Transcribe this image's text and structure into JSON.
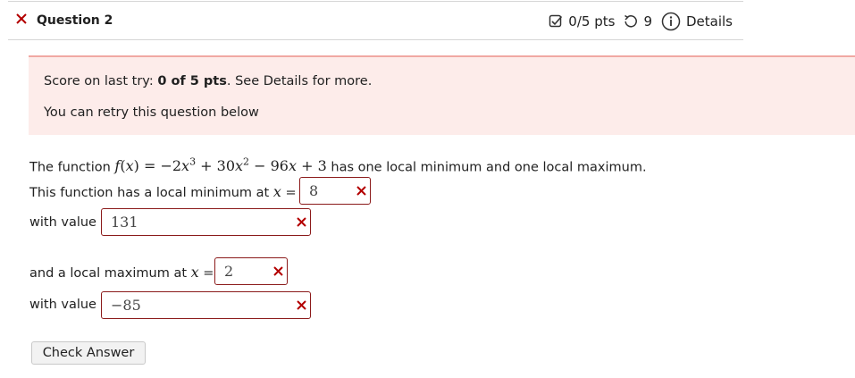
{
  "question": {
    "title": "Question 2",
    "status_icon": "x-icon",
    "score": "0/5 pts",
    "retries": "9",
    "details_label": "Details",
    "icons": [
      "checkbox-icon",
      "retry-icon",
      "info-icon"
    ]
  },
  "alert": {
    "score_prefix": "Score on last try: ",
    "score_bold": "0 of 5 pts",
    "score_suffix": ". See Details for more.",
    "retry_text": "You can retry this question below"
  },
  "problem": {
    "intro_prefix": "The function ",
    "intro_suffix": " has one local minimum and one local maximum.",
    "min_label": "This function has a local minimum at",
    "with_value_label": "with value",
    "max_label": "and a local maximum at",
    "x_equals": "=",
    "math": {
      "fx": "f(x) = −2x³ + 30x² − 96x + 3",
      "x_var": "x"
    }
  },
  "answers": {
    "min_x": "8",
    "min_value": "131",
    "max_x": "2",
    "max_value": "−85",
    "status": "incorrect"
  },
  "buttons": {
    "check_answer": "Check Answer"
  },
  "colors": {
    "wrong": "#b30000",
    "alert_bg": "#fdecea",
    "alert_border": "#f0a8a3",
    "input_border": "#8b1a1a"
  }
}
